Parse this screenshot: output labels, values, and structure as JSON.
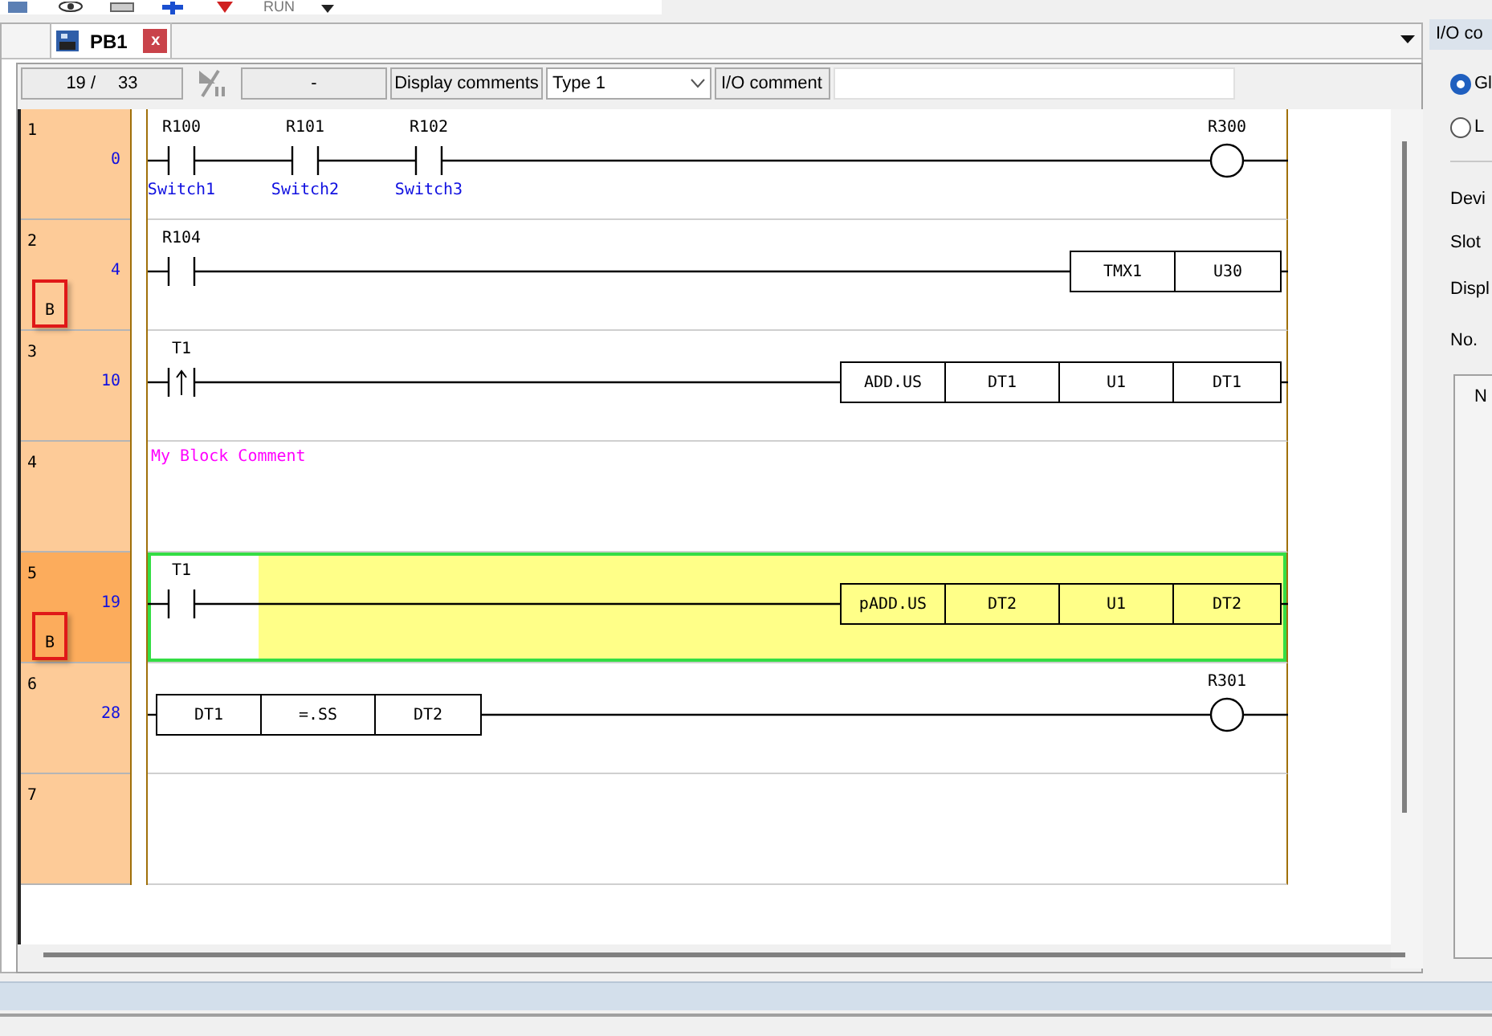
{
  "toolbar": {
    "run_label": "RUN"
  },
  "tab": {
    "label": "PB1",
    "close": "x",
    "selected": true
  },
  "status_bar": {
    "position": "19 /",
    "total": "33",
    "field_3": "-",
    "display_comments": "Display comments",
    "type": "Type 1",
    "io_comment_label": "I/O comment"
  },
  "rungs": [
    {
      "kind": "ladder",
      "line": "1",
      "step": "0",
      "selected": false,
      "bookmark": false,
      "inputs": [
        {
          "kind": "contact",
          "device": "R100",
          "comment": "Switch1"
        },
        {
          "kind": "contact",
          "device": "R101",
          "comment": "Switch2"
        },
        {
          "kind": "contact",
          "device": "R102",
          "comment": "Switch3"
        }
      ],
      "output": {
        "kind": "coil",
        "device": "R300"
      }
    },
    {
      "kind": "ladder",
      "line": "2",
      "step": "4",
      "selected": false,
      "bookmark": true,
      "mark": "B",
      "inputs": [
        {
          "kind": "contact",
          "device": "R104"
        }
      ],
      "output": {
        "kind": "box",
        "cells": [
          "TMX1",
          "U30"
        ]
      }
    },
    {
      "kind": "ladder",
      "line": "3",
      "step": "10",
      "selected": false,
      "bookmark": false,
      "inputs": [
        {
          "kind": "rising_contact",
          "device": "T1"
        }
      ],
      "output": {
        "kind": "box",
        "cells": [
          "ADD.US",
          "DT1",
          "U1",
          "DT1"
        ]
      }
    },
    {
      "kind": "comment",
      "line": "4",
      "comment": "My Block Comment"
    },
    {
      "kind": "ladder",
      "line": "5",
      "step": "19",
      "selected": true,
      "bookmark": true,
      "mark": "B",
      "inputs": [
        {
          "kind": "contact",
          "device": "T1"
        }
      ],
      "output": {
        "kind": "box",
        "cells": [
          "pADD.US",
          "DT2",
          "U1",
          "DT2"
        ]
      }
    },
    {
      "kind": "ladder",
      "line": "6",
      "step": "28",
      "selected": false,
      "bookmark": false,
      "inputs": [
        {
          "kind": "compare",
          "cells": [
            "DT1",
            "=.SS",
            "DT2"
          ]
        }
      ],
      "output": {
        "kind": "coil",
        "device": "R301"
      }
    },
    {
      "kind": "empty",
      "line": "7"
    }
  ],
  "side_panel": {
    "title": "I/O co",
    "radios": [
      {
        "label": "Gl",
        "selected": true
      },
      {
        "label": "L",
        "selected": false
      }
    ],
    "labels": [
      "Devi",
      "Slot",
      "Displ",
      "No."
    ],
    "list_header": "N"
  }
}
